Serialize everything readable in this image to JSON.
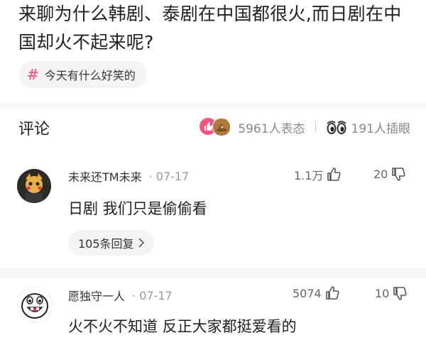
{
  "post": {
    "title": "来聊为什么韩剧、泰剧在中国都很火,而日剧在中国却火不起来呢?",
    "topic": "今天有什么好笑的",
    "topic_icon": "hash-icon"
  },
  "comments_section": {
    "title": "评论",
    "reactions_count": "5961人表态",
    "peek_count": "191人插眼"
  },
  "comments": [
    {
      "author": "未来还TM未来",
      "date": "· 07-17",
      "likes": "1.1万",
      "dislikes": "20",
      "text": "日剧 我们只是偷偷看",
      "replies": "105条回复"
    },
    {
      "author": "愿独守一人",
      "date": "· 07-17",
      "likes": "5074",
      "dislikes": "10",
      "text": "火不火不知道 反正大家都挺爱看的"
    }
  ],
  "colors": {
    "accent_pink": "#f3668c",
    "muted": "#999999"
  }
}
